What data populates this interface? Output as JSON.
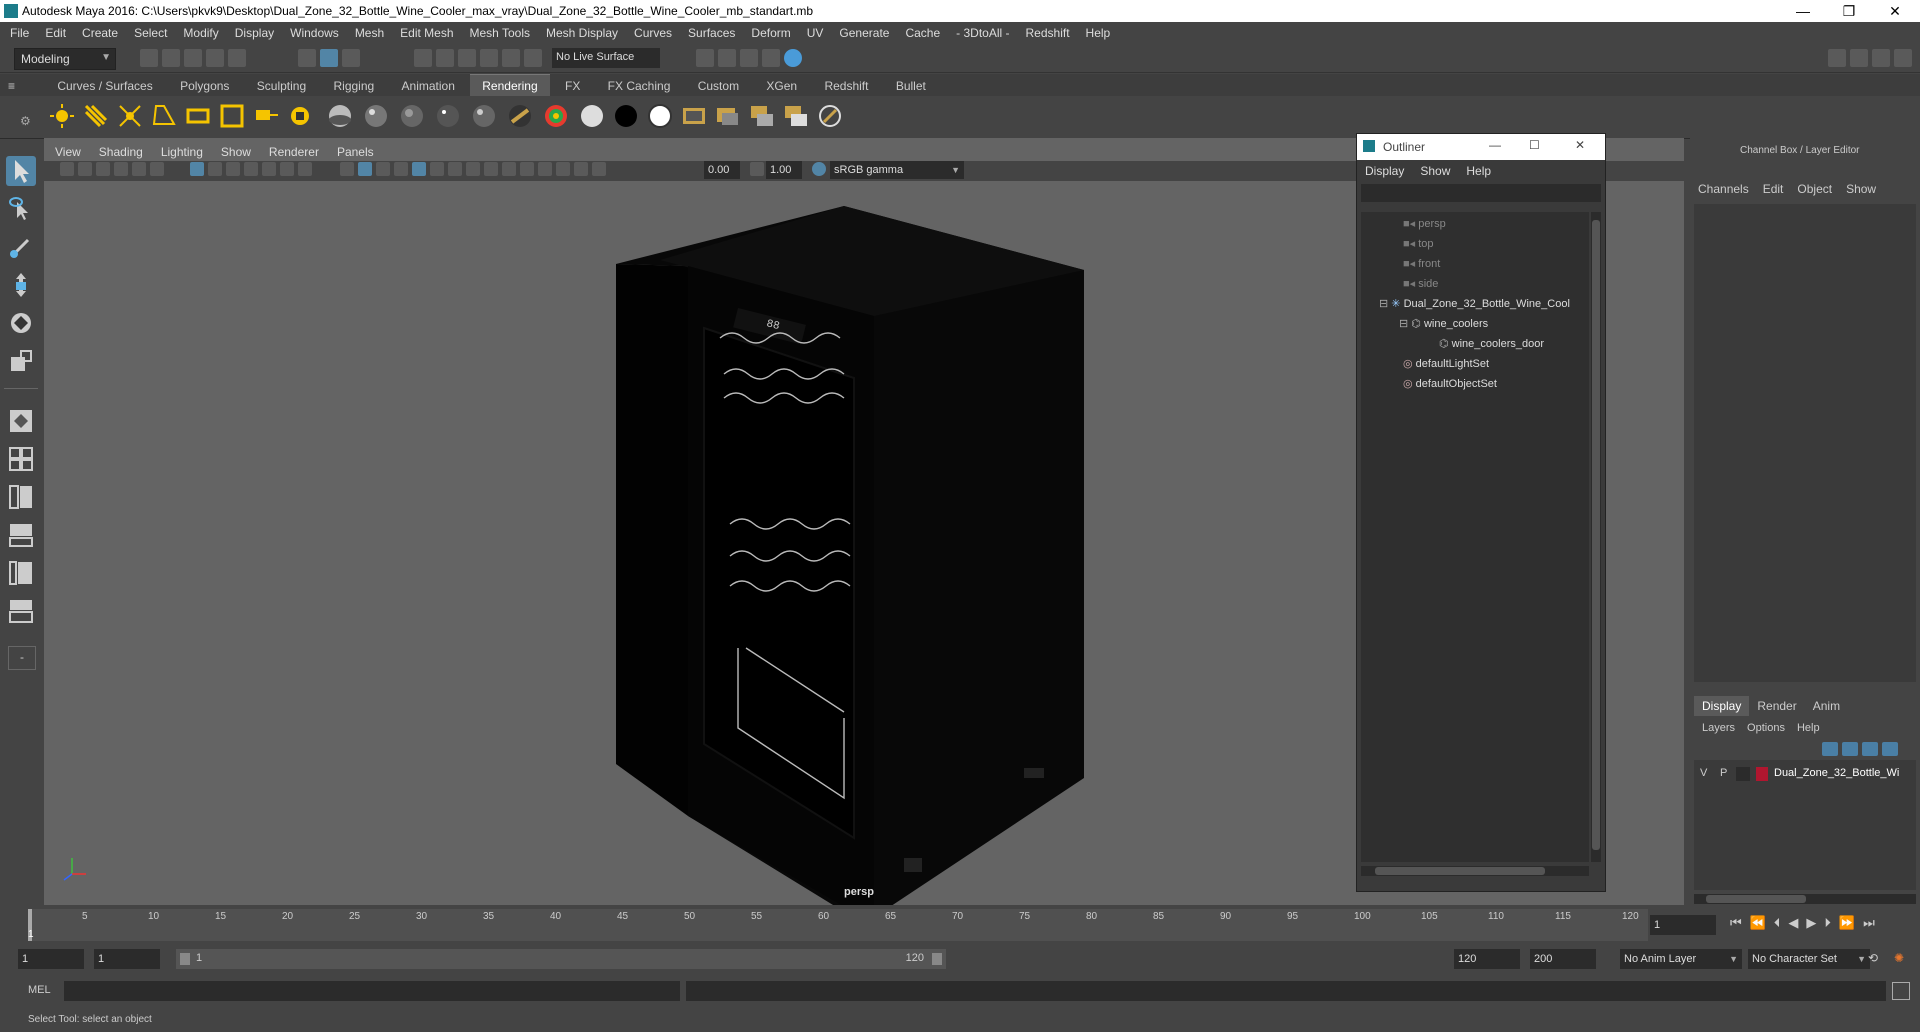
{
  "window": {
    "title": "Autodesk Maya 2016: C:\\Users\\pkvk9\\Desktop\\Dual_Zone_32_Bottle_Wine_Cooler_max_vray\\Dual_Zone_32_Bottle_Wine_Cooler_mb_standart.mb",
    "minimize": "—",
    "restore": "❐",
    "close": "✕"
  },
  "menubar": [
    "File",
    "Edit",
    "Create",
    "Select",
    "Modify",
    "Display",
    "Windows",
    "Mesh",
    "Edit Mesh",
    "Mesh Tools",
    "Mesh Display",
    "Curves",
    "Surfaces",
    "Deform",
    "UV",
    "Generate",
    "Cache",
    "- 3DtoAll -",
    "Redshift",
    "Help"
  ],
  "statusline": {
    "mode": "Modeling",
    "live_surface": "No Live Surface"
  },
  "shelf_tabs": [
    "Curves / Surfaces",
    "Polygons",
    "Sculpting",
    "Rigging",
    "Animation",
    "Rendering",
    "FX",
    "FX Caching",
    "Custom",
    "XGen",
    "Redshift",
    "Bullet"
  ],
  "shelf_active": "Rendering",
  "viewport": {
    "menu": [
      "View",
      "Shading",
      "Lighting",
      "Show",
      "Renderer",
      "Panels"
    ],
    "exposure": "0.00",
    "gamma": "1.00",
    "color_space": "sRGB gamma",
    "camera_label": "persp"
  },
  "outliner": {
    "title": "Outliner",
    "menu": [
      "Display",
      "Show",
      "Help"
    ],
    "items": [
      {
        "label": "persp",
        "dim": true,
        "depth": 0
      },
      {
        "label": "top",
        "dim": true,
        "depth": 0
      },
      {
        "label": "front",
        "dim": true,
        "depth": 0
      },
      {
        "label": "side",
        "dim": true,
        "depth": 0
      },
      {
        "label": "Dual_Zone_32_Bottle_Wine_Cool",
        "dim": false,
        "depth": 0
      },
      {
        "label": "wine_coolers",
        "dim": false,
        "depth": 1
      },
      {
        "label": "wine_coolers_door",
        "dim": false,
        "depth": 2
      },
      {
        "label": "defaultLightSet",
        "dim": false,
        "depth": 0
      },
      {
        "label": "defaultObjectSet",
        "dim": false,
        "depth": 0
      }
    ]
  },
  "channel_box": {
    "title": "Channel Box / Layer Editor",
    "menu": [
      "Channels",
      "Edit",
      "Object",
      "Show"
    ],
    "layer_tabs": [
      "Display",
      "Render",
      "Anim"
    ],
    "layer_menu": [
      "Layers",
      "Options",
      "Help"
    ],
    "layer": {
      "v": "V",
      "p": "P",
      "name": "Dual_Zone_32_Bottle_Wi",
      "color": "#b0162f"
    }
  },
  "timeline": {
    "ticks": [
      "1",
      "5",
      "10",
      "15",
      "20",
      "25",
      "30",
      "35",
      "40",
      "45",
      "50",
      "55",
      "60",
      "65",
      "70",
      "75",
      "80",
      "85",
      "90",
      "95",
      "100",
      "105",
      "110",
      "115",
      "120"
    ],
    "current_frame": "1"
  },
  "range": {
    "start": "1",
    "start2": "1",
    "slider_start": "1",
    "slider_end": "120",
    "end": "120",
    "end2": "200",
    "anim_layer": "No Anim Layer",
    "char_set": "No Character Set"
  },
  "cmdline": {
    "label": "MEL"
  },
  "help_text": "Select Tool: select an object",
  "colors": {
    "bg": "#444444",
    "viewport": "#646464",
    "accent": "#5285a6"
  }
}
